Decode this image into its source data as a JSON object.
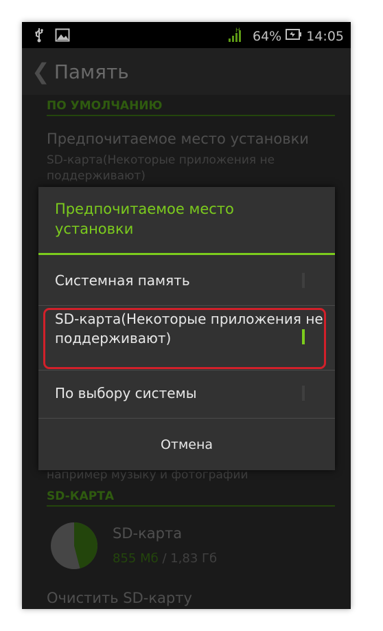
{
  "statusbar": {
    "left_icons": [
      "usb-icon",
      "image-icon"
    ],
    "battery_percent": "64%",
    "time": "14:05",
    "right_icons": [
      "signal-icon",
      "battery-icon"
    ]
  },
  "actionbar": {
    "title": "Память"
  },
  "background": {
    "section_default": "ПО УМОЛЧАНИЮ",
    "pref_install_location_title": "Предпочитаемое место установки",
    "pref_install_location_value": "SD-карта(Некоторые приложения не поддерживают)",
    "partial_hint": "например музыку и фотографии",
    "section_sd": "SD-КАРТА",
    "sd_card_name": "SD-карта",
    "sd_used": "855 Мб",
    "sd_separator": " / ",
    "sd_total": "1,83 Гб",
    "sd_used_fraction": 0.46,
    "clear_sd": "Очистить SD-карту"
  },
  "dialog": {
    "title": "Предпочитаемое место установки",
    "options": [
      {
        "label": "Системная память",
        "selected": false
      },
      {
        "label": "SD-карта(Некоторые приложения не поддерживают)",
        "selected": true
      },
      {
        "label": "По выбору системы",
        "selected": false
      }
    ],
    "cancel_label": "Отмена"
  },
  "colors": {
    "accent": "#7ccc1d",
    "highlight_border": "#d2202a",
    "dialog_bg": "#323232"
  }
}
